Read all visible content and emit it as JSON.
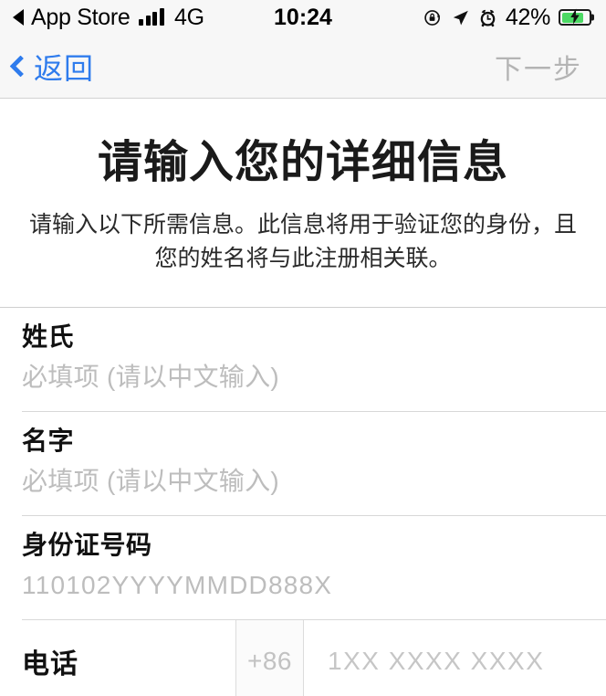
{
  "status_bar": {
    "back_arrow_icon": "triangle-left-icon",
    "carrier_app": "App Store",
    "signal_icon": "signal-bars-icon",
    "network_type": "4G",
    "time": "10:24",
    "rotation_lock_icon": "rotation-lock-icon",
    "location_icon": "location-arrow-icon",
    "alarm_icon": "alarm-clock-icon",
    "battery_percent": "42%",
    "battery_icon": "battery-charging-icon",
    "battery_level": 42,
    "battery_color": "#4cd964"
  },
  "nav_bar": {
    "back_icon": "chevron-left-icon",
    "back_label": "返回",
    "next_label": "下一步",
    "accent_color": "#2f7ced",
    "disabled_color": "#b4b4b4"
  },
  "main": {
    "title": "请输入您的详细信息",
    "subtitle": "请输入以下所需信息。此信息将用于验证您的身份，且您的姓名将与此注册相关联。",
    "fields": [
      {
        "label": "姓氏",
        "placeholder": "必填项 (请以中文输入)",
        "value": ""
      },
      {
        "label": "名字",
        "placeholder": "必填项 (请以中文输入)",
        "value": ""
      },
      {
        "label": "身份证号码",
        "placeholder": "110102YYYYMMDD888X",
        "value": ""
      }
    ],
    "phone_field": {
      "label": "电话",
      "country_code": "+86",
      "placeholder": "1XX XXXX XXXX",
      "value": ""
    }
  }
}
